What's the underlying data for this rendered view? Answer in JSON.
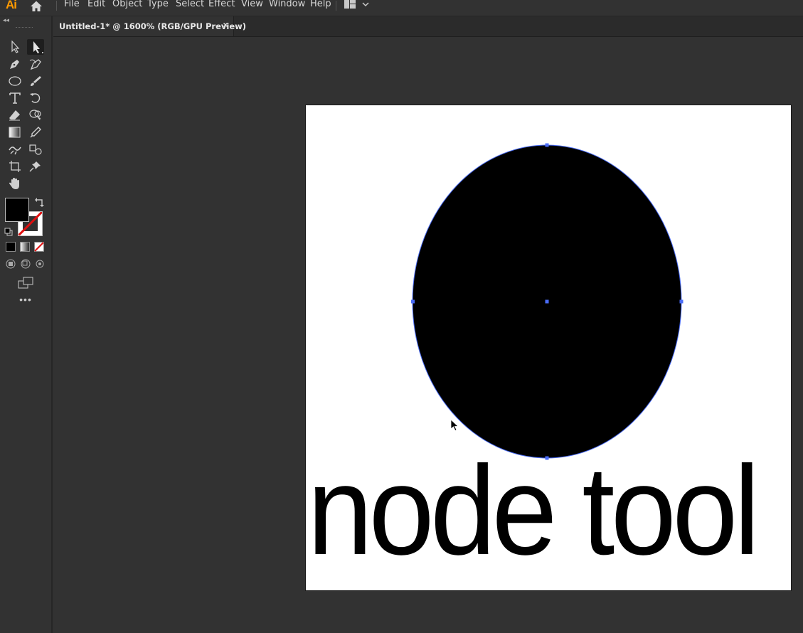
{
  "app": {
    "logo": "Ai"
  },
  "menubar": {
    "items": [
      "File",
      "Edit",
      "Object",
      "Type",
      "Select",
      "Effect",
      "View",
      "Window",
      "Help"
    ]
  },
  "document_tab": {
    "title": "Untitled-1* @ 1600% (RGB/GPU Preview)",
    "close_label": "×"
  },
  "toolbar": {
    "collapse_label": "◂◂",
    "tools": [
      "selection-tool",
      "direct-selection-tool",
      "pen-tool",
      "curvature-tool",
      "ellipse-tool",
      "paintbrush-tool",
      "type-tool",
      "rotate-tool",
      "eraser-tool",
      "shape-builder-tool",
      "gradient-tool",
      "eyedropper-tool",
      "puppet-warp-tool",
      "symbol-sprayer-tool",
      "artboard-tool",
      "pin-tool",
      "hand-tool"
    ],
    "active_tool": "direct-selection-tool",
    "fill_color": "#000000",
    "stroke": "none",
    "more_label": "•••"
  },
  "canvas": {
    "text": "node tool",
    "selection_color": "#4a6cf7",
    "shape_fill": "#000000"
  }
}
